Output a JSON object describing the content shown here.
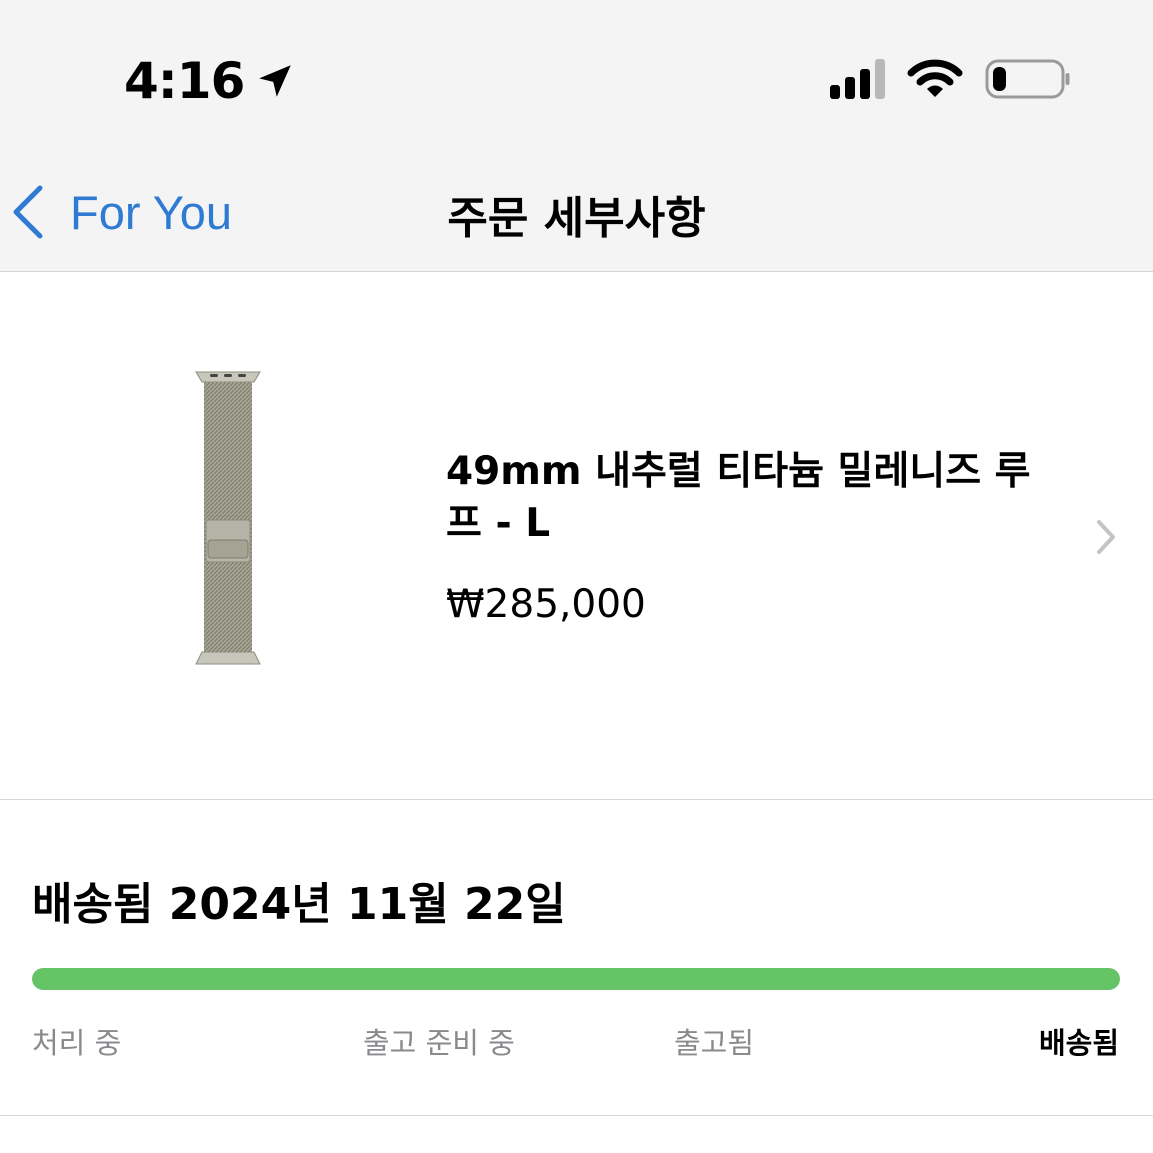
{
  "status_bar": {
    "time": "4:16",
    "location_icon": "location-arrow-icon",
    "signal_icon": "cellular-signal-icon",
    "wifi_icon": "wifi-icon",
    "battery_icon": "battery-icon",
    "battery_level": 0.2
  },
  "nav": {
    "back_label": "For You",
    "title": "주문 세부사항",
    "back_icon": "chevron-left-icon"
  },
  "product": {
    "name": "49mm 내추럴 티타늄 밀레니즈 루프 - L",
    "price": "₩285,000",
    "image_icon": "watch-band-image",
    "disclosure_icon": "chevron-right-icon"
  },
  "delivery": {
    "title": "배송됨 2024년 11월 22일",
    "progress": 1.0,
    "steps": [
      {
        "label": "처리 중",
        "active": false
      },
      {
        "label": "출고 준비 중",
        "active": false
      },
      {
        "label": "출고됨",
        "active": false
      },
      {
        "label": "배송됨",
        "active": true
      }
    ]
  },
  "colors": {
    "accent": "#2f7bd4",
    "progress": "#65c466",
    "muted_text": "#8a8a8e"
  }
}
